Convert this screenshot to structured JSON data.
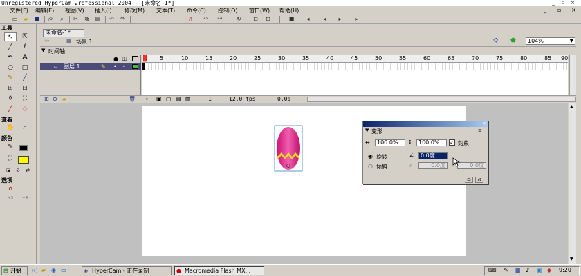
{
  "window": {
    "title": "Unregistered HyperCam 2rofessional 2004 - [未命名-1*]",
    "controls": [
      "minimize-icon",
      "restore-icon",
      "close-icon"
    ]
  },
  "menubar": {
    "items": [
      "文件(F)",
      "编辑(E)",
      "视图(V)",
      "插入(I)",
      "修改(M)",
      "文本(T)",
      "命令(C)",
      "控制(O)",
      "窗口(W)",
      "帮助(H)"
    ]
  },
  "toolbar": {
    "icons": [
      "new-file-icon",
      "open-folder-icon",
      "save-icon",
      "print-icon",
      "print-preview-icon",
      "cut-icon",
      "copy-icon",
      "paste-icon",
      "undo-icon",
      "redo-icon",
      "snap-magnet-icon",
      "smooth-icon",
      "straighten-icon",
      "rotate-icon",
      "scale-icon",
      "align-icon"
    ]
  },
  "tools": {
    "title": "工具",
    "view_label": "查看",
    "colors_label": "颜色",
    "options_label": "选项",
    "fill_color": "#ffff00"
  },
  "document": {
    "tab": "未命名-1*",
    "scene": "场景 1",
    "zoom": "104%"
  },
  "timeline": {
    "title": "时间轴",
    "layer_name": "图层 1",
    "frame_numbers": [
      "1",
      "5",
      "10",
      "15",
      "20",
      "25",
      "30",
      "35",
      "40",
      "45",
      "50",
      "55",
      "60",
      "65",
      "70",
      "75",
      "80",
      "85",
      "90"
    ],
    "current_frame": "1",
    "fps": "12.0 fps",
    "time": "0.0s"
  },
  "transform_panel": {
    "title": "变形",
    "width_pct": "100.0%",
    "height_pct": "100.0%",
    "constrain_label": "约束",
    "rotate_label": "旋转",
    "rotate_value": "0.0度",
    "skew_label": "倾斜",
    "skew_h": "0.0度",
    "skew_v": "0.0度"
  },
  "taskbar": {
    "start": "开始",
    "tasks": [
      "HyperCam - 正在录制",
      "Macromedia Flash MX..."
    ],
    "clock": "9:20"
  },
  "colors": {
    "accent": "#0a246a",
    "egg_pink": "#e8388f",
    "egg_stripe": "#f0e020",
    "selection": "#5b9bd5"
  }
}
